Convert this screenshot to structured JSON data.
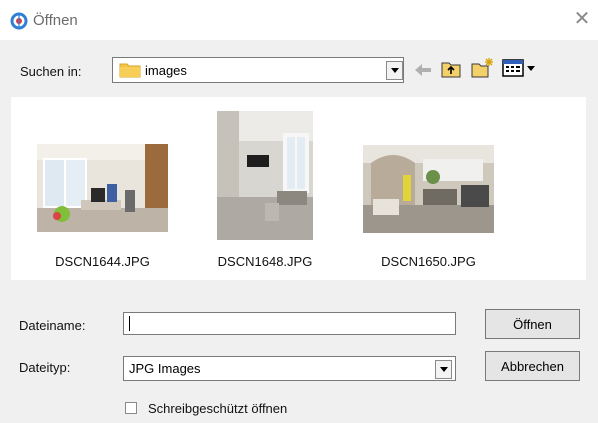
{
  "window": {
    "title": "Öffnen",
    "close_label": "✕"
  },
  "lookin": {
    "label": "Suchen in:",
    "value": "images"
  },
  "files": [
    {
      "name": "DSCN1644.JPG"
    },
    {
      "name": "DSCN1648.JPG"
    },
    {
      "name": "DSCN1650.JPG"
    }
  ],
  "form": {
    "filename_label": "Dateiname:",
    "filename_value": "",
    "filetype_label": "Dateityp:",
    "filetype_value": "JPG Images",
    "readonly_label": "Schreibgeschützt öffnen",
    "readonly_checked": false
  },
  "buttons": {
    "open": "Öffnen",
    "cancel": "Abbrechen"
  }
}
